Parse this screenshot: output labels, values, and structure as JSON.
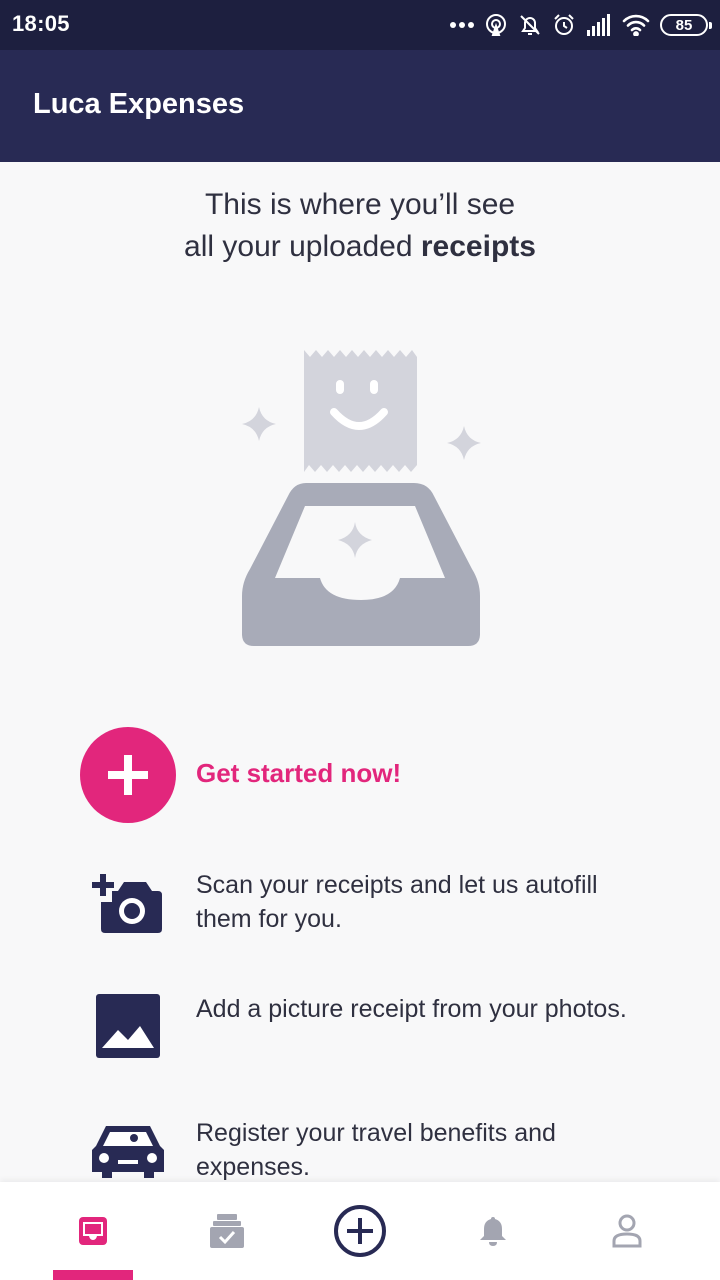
{
  "status_bar": {
    "time": "18:05",
    "battery": "85",
    "icons": [
      "more-dots-icon",
      "hotspot-icon",
      "mute-bell-icon",
      "alarm-icon",
      "signal-icon",
      "wifi-icon",
      "battery-icon"
    ]
  },
  "app_bar": {
    "title": "Luca Expenses"
  },
  "empty_state": {
    "line1": "This is where you’ll see",
    "line2_prefix": "all your uploaded ",
    "line2_bold": "receipts",
    "illustration": "receipt-inbox-illustration"
  },
  "cta": {
    "label": "Get started now!",
    "icon": "plus-icon"
  },
  "features": [
    {
      "icon": "add-camera-icon",
      "text": "Scan your receipts and let us autofill them for you."
    },
    {
      "icon": "image-icon",
      "text": "Add a picture receipt from your photos."
    },
    {
      "icon": "car-icon",
      "text": "Register your travel benefits and expenses."
    }
  ],
  "bottom_nav": {
    "active": "inbox",
    "items": [
      {
        "id": "inbox",
        "icon": "inbox-icon"
      },
      {
        "id": "approved",
        "icon": "approved-receipts-icon"
      },
      {
        "id": "add",
        "icon": "add-circle-icon"
      },
      {
        "id": "notifications",
        "icon": "bell-icon"
      },
      {
        "id": "profile",
        "icon": "profile-icon"
      }
    ]
  },
  "colors": {
    "status_bar": "#1d1f3f",
    "app_bar": "#282a54",
    "accent": "#e2267c",
    "icon_dark": "#282a54",
    "illustration_gray": "#a8abb8",
    "illustration_light": "#d3d4dc",
    "nav_inactive": "#a3a5b1"
  }
}
